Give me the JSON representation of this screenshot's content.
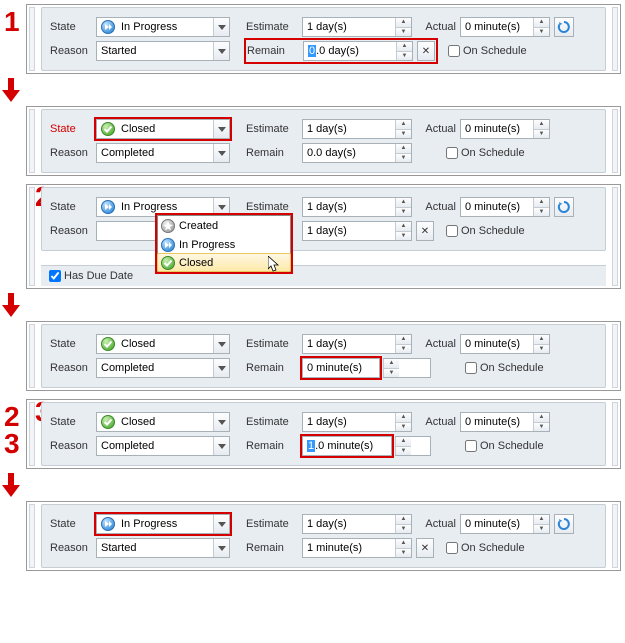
{
  "labels": {
    "state": "State",
    "reason": "Reason",
    "estimate": "Estimate",
    "remain": "Remain",
    "actual": "Actual",
    "onSchedule": "On Schedule",
    "hasDueDate": "Has Due Date"
  },
  "status": {
    "inProgress": "In Progress",
    "closed": "Closed",
    "created": "Created",
    "started": "Started",
    "completed": "Completed"
  },
  "panels": [
    {
      "step": "1",
      "state": "inProgress",
      "reason": "started",
      "estimate": "1 day(s)",
      "remain": "0.0 day(s)",
      "remainSelPrefix": "0",
      "remainSuffix": ".0 day(s)",
      "actual": "0 minute(s)",
      "showX": true,
      "showRefresh": true,
      "hlState": false,
      "hlRemainRow": true,
      "hlRemainBoxOnly": false
    },
    {
      "state": "closed",
      "reason": "completed",
      "estimate": "1 day(s)",
      "remain": "0.0 day(s)",
      "actual": "0 minute(s)",
      "showX": false,
      "showRefresh": false,
      "hlState": true,
      "hlStateLabel": true
    },
    {
      "step": "2",
      "state": "inProgress",
      "reason": "—",
      "estimate": "1 day(s)",
      "remain": "1 day(s)",
      "actual": "0 minute(s)",
      "showX": true,
      "showRefresh": true,
      "dropdown": true,
      "hlDropdown": true,
      "hasDueDate": true
    },
    {
      "state": "closed",
      "stateDotted": true,
      "reason": "completed",
      "estimate": "1 day(s)",
      "remain": "0 minute(s)",
      "actual": "0 minute(s)",
      "showX": false,
      "showRefresh": false,
      "hlRemainBoxOnly": true
    },
    {
      "step": "3",
      "state": "closed",
      "stateDotted": true,
      "reason": "completed",
      "estimate": "1 day(s)",
      "remain": "1.0 minute(s)",
      "remainSelPrefix": "1",
      "remainSuffix": ".0 minute(s)",
      "actual": "0 minute(s)",
      "showX": false,
      "showRefresh": false,
      "hlRemainBoxOnly": true
    },
    {
      "state": "inProgress",
      "reason": "started",
      "estimate": "1 day(s)",
      "remain": "1 minute(s)",
      "actual": "0 minute(s)",
      "showX": true,
      "showRefresh": true,
      "hlState": true
    }
  ]
}
